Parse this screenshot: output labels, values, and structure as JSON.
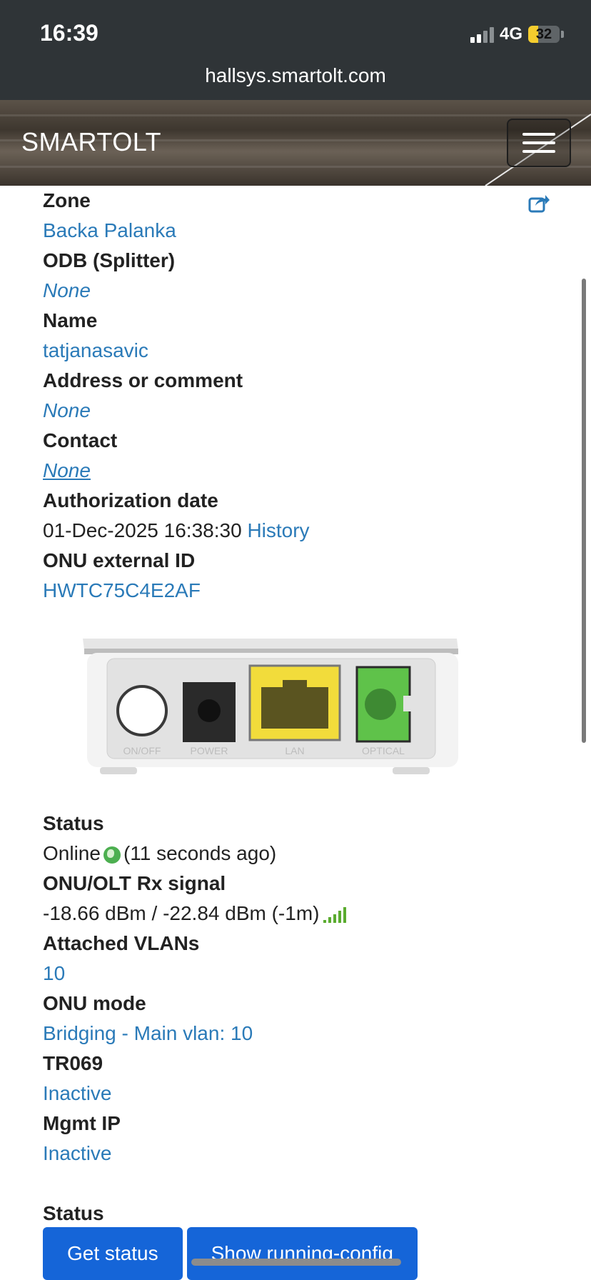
{
  "status_bar": {
    "time": "16:39",
    "network": "4G",
    "battery": "32",
    "battery_level": 0.32,
    "url": "hallsys.smartolt.com"
  },
  "navbar": {
    "brand": "SMARTOLT",
    "menu_icon": "hamburger-menu-icon"
  },
  "details": {
    "zone_label": "Zone",
    "zone_value": "Backa Palanka",
    "odb_label": "ODB (Splitter)",
    "odb_value": "None",
    "name_label": "Name",
    "name_value": "tatjanasavic",
    "address_label": "Address or comment",
    "address_value": "None",
    "contact_label": "Contact",
    "contact_value": "None",
    "auth_label": "Authorization date",
    "auth_date": "01-Dec-2025 16:38:30",
    "auth_history": "History",
    "ext_id_label": "ONU external ID",
    "ext_id_value": "HWTC75C4E2AF"
  },
  "device_image": {
    "port_labels": [
      "ON/OFF",
      "POWER",
      "LAN",
      "OPTICAL"
    ]
  },
  "status_info": {
    "status_label": "Status",
    "status_online": "Online",
    "status_ago": "(11 seconds ago)",
    "rx_label": "ONU/OLT Rx signal",
    "rx_value": "-18.66 dBm / -22.84 dBm (-1m)",
    "vlans_label": "Attached VLANs",
    "vlans_value": "10",
    "mode_label": "ONU mode",
    "mode_value": "Bridging - Main vlan: 10",
    "tr069_label": "TR069",
    "tr069_value": "Inactive",
    "mgmt_label": "Mgmt IP",
    "mgmt_value": "Inactive"
  },
  "actions": {
    "section_label": "Status",
    "get_status": "Get status",
    "show_config": "Show running-config"
  },
  "colors": {
    "link": "#2a7ab8",
    "button": "#1565d8",
    "status_bar_bg": "#2f3437",
    "signal_green": "#5aab2f"
  }
}
